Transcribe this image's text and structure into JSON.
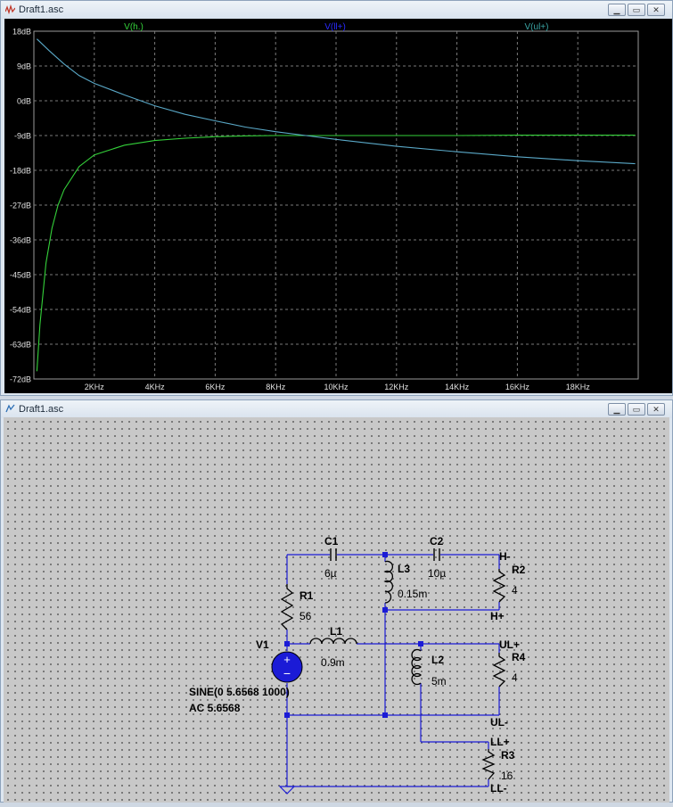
{
  "plot_window": {
    "title": "Draft1.asc",
    "traces": [
      {
        "name": "V(h.)",
        "color": "#2ecc40"
      },
      {
        "name": "V(ll+)",
        "color": "#2a2aff"
      },
      {
        "name": "V(ul+)",
        "color": "#3aa5a5"
      }
    ]
  },
  "schematic_window": {
    "title": "Draft1.asc",
    "components": {
      "c1_name": "C1",
      "c1_value": "6µ",
      "c2_name": "C2",
      "c2_value": "10µ",
      "l3_name": "L3",
      "l3_value": "0.15m",
      "l1_name": "L1",
      "l1_value": "0.9m",
      "l2_name": "L2",
      "l2_value": "5m",
      "r1_name": "R1",
      "r1_value": "56",
      "r2_name": "R2",
      "r2_value": "4",
      "r4_name": "R4",
      "r4_value": "4",
      "r3_name": "R3",
      "r3_value": "16",
      "v1_name": "V1",
      "v1_line1": "SINE(0 5.6568 1000)",
      "v1_line2": "AC 5.6568"
    },
    "net_labels": {
      "h_minus": "H-",
      "h_plus": "H+",
      "ul_plus": "UL+",
      "ul_minus": "UL-",
      "ll_plus": "LL+",
      "ll_minus": "LL-"
    }
  },
  "colors": {
    "plot_bg": "#000000",
    "grid": "#7a7a7a",
    "green_trace": "#34d13a",
    "cyan_trace": "#5aa9c8",
    "wire": "#1b1bd6",
    "component_text": "#000000"
  },
  "chart_data": {
    "type": "line",
    "x_unit": "Hz",
    "y_unit": "dB",
    "xlim": [
      0,
      20000
    ],
    "ylim": [
      -72,
      18
    ],
    "x_ticks": [
      "2KHz",
      "4KHz",
      "6KHz",
      "8KHz",
      "10KHz",
      "12KHz",
      "14KHz",
      "16KHz",
      "18KHz"
    ],
    "y_ticks": [
      "18dB",
      "9dB",
      "0dB",
      "-9dB",
      "-18dB",
      "-27dB",
      "-36dB",
      "-45dB",
      "-54dB",
      "-63dB",
      "-72dB"
    ],
    "grid": true,
    "series": [
      {
        "name": "V(h.)",
        "x": [
          100,
          200,
          400,
          600,
          800,
          1000,
          1500,
          2000,
          3000,
          4000,
          5000,
          6000,
          7000,
          8000,
          9000,
          10000,
          12000,
          14000,
          16000,
          18000,
          19900
        ],
        "y": [
          -70,
          -58,
          -42,
          -33,
          -27,
          -23,
          -17,
          -14,
          -11.5,
          -10.3,
          -9.7,
          -9.3,
          -9.1,
          -9,
          -9,
          -9,
          -9,
          -9,
          -8.9,
          -8.9,
          -8.9
        ]
      },
      {
        "name": "V(ul+)",
        "x": [
          100,
          500,
          1000,
          1500,
          2000,
          3000,
          4000,
          5000,
          6000,
          7000,
          8000,
          9000,
          10000,
          12000,
          14000,
          16000,
          18000,
          19900
        ],
        "y": [
          16,
          13,
          9.5,
          6.5,
          4.5,
          1.5,
          -1.3,
          -3.5,
          -5.2,
          -6.8,
          -8,
          -9,
          -10,
          -11.8,
          -13.2,
          -14.5,
          -15.5,
          -16.3
        ]
      }
    ]
  }
}
